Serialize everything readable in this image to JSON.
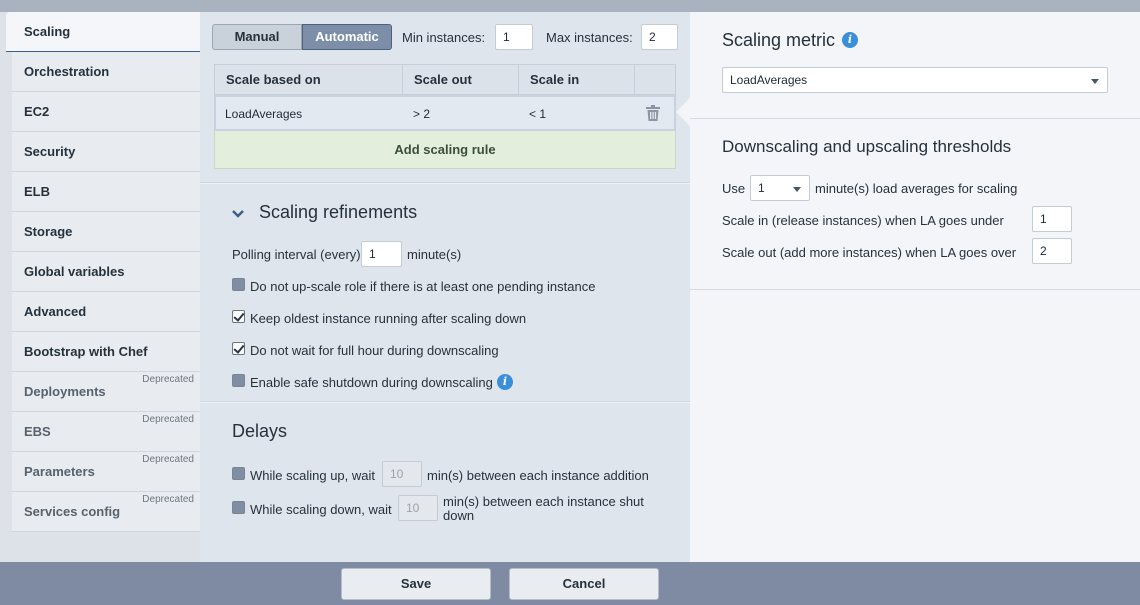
{
  "sidebar": {
    "items": [
      {
        "label": "Scaling"
      },
      {
        "label": "Orchestration"
      },
      {
        "label": "EC2"
      },
      {
        "label": "Security"
      },
      {
        "label": "ELB"
      },
      {
        "label": "Storage"
      },
      {
        "label": "Global variables"
      },
      {
        "label": "Advanced"
      },
      {
        "label": "Bootstrap with Chef"
      },
      {
        "label": "Deployments",
        "tag": "Deprecated"
      },
      {
        "label": "EBS",
        "tag": "Deprecated"
      },
      {
        "label": "Parameters",
        "tag": "Deprecated"
      },
      {
        "label": "Services config",
        "tag": "Deprecated"
      }
    ]
  },
  "mode": {
    "manual": "Manual",
    "automatic": "Automatic",
    "selected": "Automatic"
  },
  "instances": {
    "min_label": "Min instances:",
    "min_value": "1",
    "max_label": "Max instances:",
    "max_value": "2"
  },
  "rules_grid": {
    "headers": [
      "Scale based on",
      "Scale out",
      "Scale in"
    ],
    "rows": [
      {
        "metric": "LoadAverages",
        "scale_out": "> 2",
        "scale_in": "< 1"
      }
    ],
    "add_label": "Add scaling rule"
  },
  "refinements": {
    "title": "Scaling refinements",
    "polling_label": "Polling interval (every)",
    "polling_value": "1",
    "polling_unit": "minute(s)",
    "options": [
      {
        "label": "Do not up-scale role if there is at least one pending instance",
        "checked": false
      },
      {
        "label": "Keep oldest instance running after scaling down",
        "checked": true
      },
      {
        "label": "Do not wait for full hour during downscaling",
        "checked": true
      },
      {
        "label": "Enable safe shutdown during downscaling",
        "checked": false
      }
    ]
  },
  "delays": {
    "title": "Delays",
    "up_label": "While scaling up, wait",
    "up_value": "10",
    "up_suffix": "min(s) between each instance addition",
    "down_label": "While scaling down, wait",
    "down_value": "10",
    "down_suffix_1": "min(s) between each instance shut",
    "down_suffix_2": "down"
  },
  "metric": {
    "title": "Scaling metric",
    "value": "LoadAverages"
  },
  "thresholds": {
    "title": "Downscaling and upscaling thresholds",
    "use_label": "Use",
    "use_value": "1",
    "use_suffix": "minute(s) load averages for scaling",
    "scale_in_label": "Scale in (release instances) when LA goes under",
    "scale_in_value": "1",
    "scale_out_label": "Scale out (add more instances) when LA goes over",
    "scale_out_value": "2"
  },
  "footer": {
    "save": "Save",
    "cancel": "Cancel"
  }
}
